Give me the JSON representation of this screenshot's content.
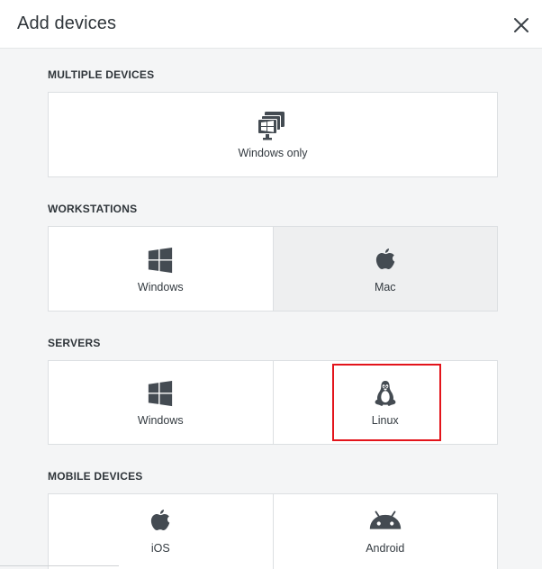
{
  "dialog": {
    "title": "Add devices",
    "close_icon": "close-icon"
  },
  "sections": {
    "multiple": {
      "title": "MULTIPLE DEVICES",
      "items": [
        {
          "label": "Windows only",
          "icon": "multiple-monitors-icon"
        }
      ]
    },
    "workstations": {
      "title": "WORKSTATIONS",
      "items": [
        {
          "label": "Windows",
          "icon": "windows-icon"
        },
        {
          "label": "Mac",
          "icon": "apple-icon",
          "hovered": true
        }
      ]
    },
    "servers": {
      "title": "SERVERS",
      "items": [
        {
          "label": "Windows",
          "icon": "windows-icon"
        },
        {
          "label": "Linux",
          "icon": "linux-icon",
          "highlighted": true
        }
      ]
    },
    "mobile": {
      "title": "MOBILE DEVICES",
      "items": [
        {
          "label": "iOS",
          "icon": "apple-icon"
        },
        {
          "label": "Android",
          "icon": "android-icon"
        }
      ]
    }
  },
  "colors": {
    "icon": "#444b52",
    "highlight_border": "#e3141b",
    "hover_tile": "#eeeff0"
  }
}
